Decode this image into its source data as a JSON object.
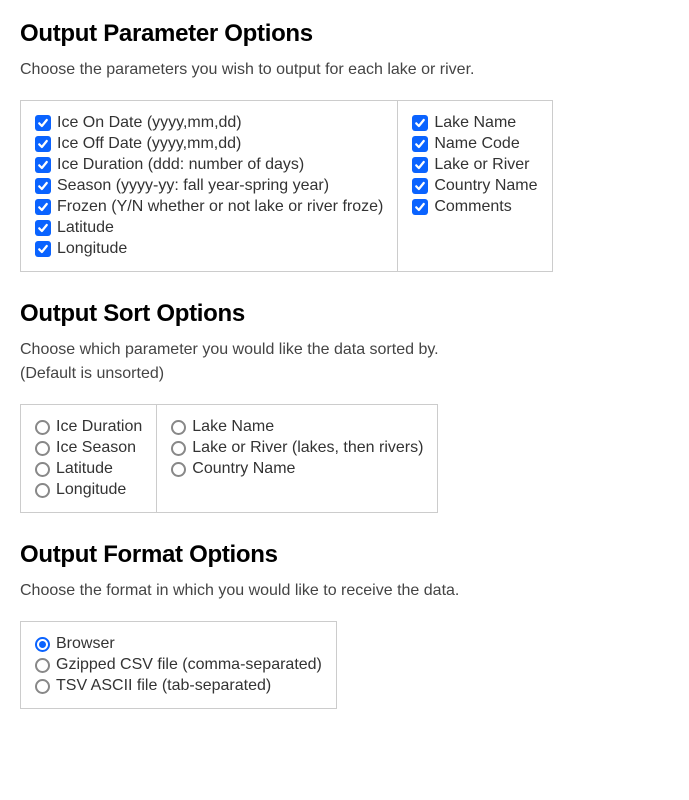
{
  "paramSection": {
    "heading": "Output Parameter Options",
    "desc": "Choose the parameters you wish to output for each lake or river.",
    "col1": [
      "Ice On Date (yyyy,mm,dd)",
      "Ice Off Date (yyyy,mm,dd)",
      "Ice Duration (ddd: number of days)",
      "Season (yyyy-yy: fall year-spring year)",
      "Frozen (Y/N whether or not lake or river froze)",
      "Latitude",
      "Longitude"
    ],
    "col2": [
      "Lake Name",
      "Name Code",
      "Lake or River",
      "Country Name",
      "Comments"
    ]
  },
  "sortSection": {
    "heading": "Output Sort Options",
    "desc1": "Choose which parameter you would like the data sorted by.",
    "desc2": "(Default is unsorted)",
    "col1": [
      "Ice Duration",
      "Ice Season",
      "Latitude",
      "Longitude"
    ],
    "col2": [
      "Lake Name",
      "Lake or River (lakes, then rivers)",
      "Country Name"
    ]
  },
  "formatSection": {
    "heading": "Output Format Options",
    "desc": "Choose the format in which you would like to receive the data.",
    "options": [
      {
        "label": "Browser",
        "selected": true
      },
      {
        "label": "Gzipped CSV file (comma-separated)",
        "selected": false
      },
      {
        "label": "TSV ASCII file (tab-separated)",
        "selected": false
      }
    ]
  }
}
